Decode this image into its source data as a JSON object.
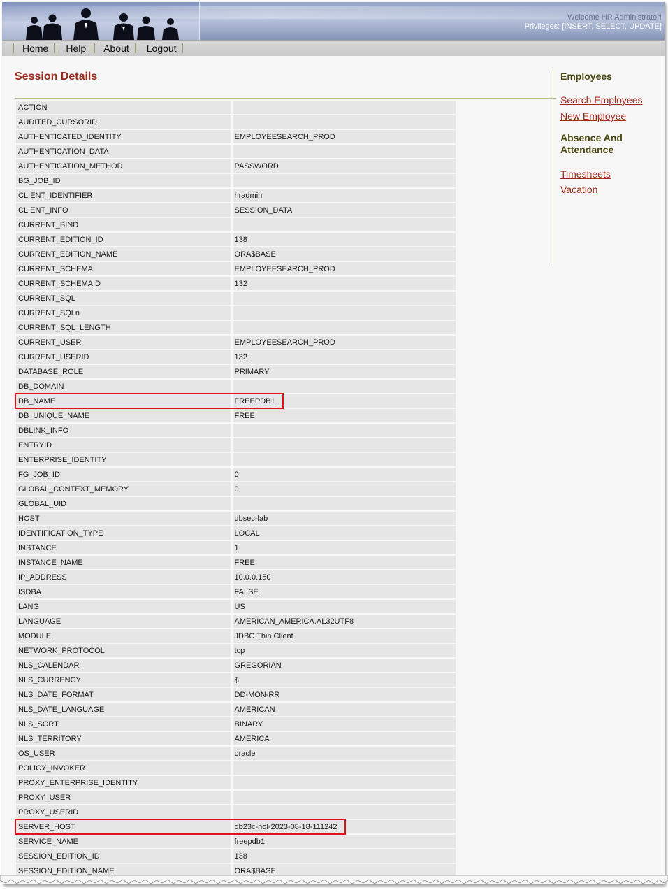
{
  "header": {
    "welcome": "Welcome HR Administrator!",
    "privileges": "Privileges: [INSERT, SELECT, UPDATE]",
    "logo_icon": "people-silhouette-icon"
  },
  "nav": {
    "items": [
      "Home",
      "Help",
      "About",
      "Logout"
    ]
  },
  "page": {
    "title": "Session Details"
  },
  "sidebar": {
    "section1_heading": "Employees",
    "section1_links": [
      "Search Employees",
      "New Employee"
    ],
    "section2_heading": "Absence And Attendance",
    "section2_links": [
      "Timesheets",
      "Vacation"
    ]
  },
  "session_rows": [
    [
      "ACTION",
      ""
    ],
    [
      "AUDITED_CURSORID",
      ""
    ],
    [
      "AUTHENTICATED_IDENTITY",
      "EMPLOYEESEARCH_PROD"
    ],
    [
      "AUTHENTICATION_DATA",
      ""
    ],
    [
      "AUTHENTICATION_METHOD",
      "PASSWORD"
    ],
    [
      "BG_JOB_ID",
      ""
    ],
    [
      "CLIENT_IDENTIFIER",
      "hradmin"
    ],
    [
      "CLIENT_INFO",
      "SESSION_DATA"
    ],
    [
      "CURRENT_BIND",
      ""
    ],
    [
      "CURRENT_EDITION_ID",
      "138"
    ],
    [
      "CURRENT_EDITION_NAME",
      "ORA$BASE"
    ],
    [
      "CURRENT_SCHEMA",
      "EMPLOYEESEARCH_PROD"
    ],
    [
      "CURRENT_SCHEMAID",
      "132"
    ],
    [
      "CURRENT_SQL",
      ""
    ],
    [
      "CURRENT_SQLn",
      ""
    ],
    [
      "CURRENT_SQL_LENGTH",
      ""
    ],
    [
      "CURRENT_USER",
      "EMPLOYEESEARCH_PROD"
    ],
    [
      "CURRENT_USERID",
      "132"
    ],
    [
      "DATABASE_ROLE",
      "PRIMARY"
    ],
    [
      "DB_DOMAIN",
      ""
    ],
    [
      "DB_NAME",
      "FREEPDB1"
    ],
    [
      "DB_UNIQUE_NAME",
      "FREE"
    ],
    [
      "DBLINK_INFO",
      ""
    ],
    [
      "ENTRYID",
      ""
    ],
    [
      "ENTERPRISE_IDENTITY",
      ""
    ],
    [
      "FG_JOB_ID",
      "0"
    ],
    [
      "GLOBAL_CONTEXT_MEMORY",
      "0"
    ],
    [
      "GLOBAL_UID",
      ""
    ],
    [
      "HOST",
      "dbsec-lab"
    ],
    [
      "IDENTIFICATION_TYPE",
      "LOCAL"
    ],
    [
      "INSTANCE",
      "1"
    ],
    [
      "INSTANCE_NAME",
      "FREE"
    ],
    [
      "IP_ADDRESS",
      "10.0.0.150"
    ],
    [
      "ISDBA",
      "FALSE"
    ],
    [
      "LANG",
      "US"
    ],
    [
      "LANGUAGE",
      "AMERICAN_AMERICA.AL32UTF8"
    ],
    [
      "MODULE",
      "JDBC Thin Client"
    ],
    [
      "NETWORK_PROTOCOL",
      "tcp"
    ],
    [
      "NLS_CALENDAR",
      "GREGORIAN"
    ],
    [
      "NLS_CURRENCY",
      "$"
    ],
    [
      "NLS_DATE_FORMAT",
      "DD-MON-RR"
    ],
    [
      "NLS_DATE_LANGUAGE",
      "AMERICAN"
    ],
    [
      "NLS_SORT",
      "BINARY"
    ],
    [
      "NLS_TERRITORY",
      "AMERICA"
    ],
    [
      "OS_USER",
      "oracle"
    ],
    [
      "POLICY_INVOKER",
      ""
    ],
    [
      "PROXY_ENTERPRISE_IDENTITY",
      ""
    ],
    [
      "PROXY_USER",
      ""
    ],
    [
      "PROXY_USERID",
      ""
    ],
    [
      "SERVER_HOST",
      "db23c-hol-2023-08-18-111242"
    ],
    [
      "SERVICE_NAME",
      "freepdb1"
    ],
    [
      "SESSION_EDITION_ID",
      "138"
    ],
    [
      "SESSION_EDITION_NAME",
      "ORA$BASE"
    ]
  ],
  "highlighted_keys": [
    "DB_NAME",
    "SERVER_HOST"
  ],
  "colors": {
    "title": "#9b2a1a",
    "link": "#a0291a",
    "heading": "#4a4a10",
    "highlight": "#e0101b",
    "row_bg": "#e6e6e6"
  }
}
